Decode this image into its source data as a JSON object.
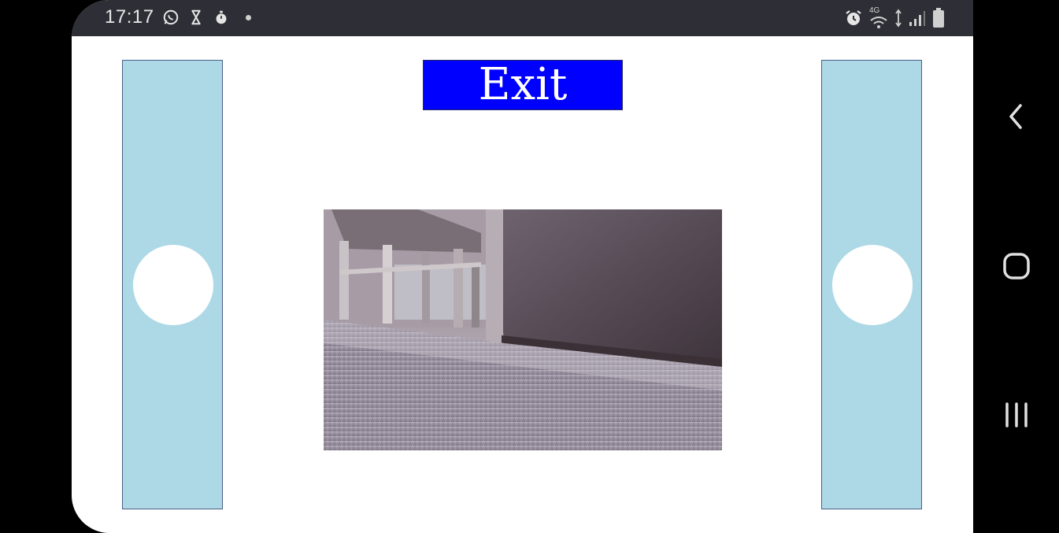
{
  "status_bar": {
    "time": "17:17",
    "left_icons": [
      "whatsapp-icon",
      "hourglass-icon",
      "stopwatch-icon",
      "notification-dot-icon"
    ],
    "right_icons": [
      "alarm-icon",
      "wifi-4g-icon",
      "data-arrows-icon",
      "cellular-signal-icon",
      "battery-icon"
    ],
    "network_label": "4G"
  },
  "controls": {
    "exit_label": "Exit",
    "left_slider_value": 0.5,
    "right_slider_value": 0.5
  },
  "camera": {
    "description_icon": "camera-feed"
  },
  "nav_bar": {
    "buttons": [
      "back-icon",
      "home-icon",
      "recents-icon"
    ]
  },
  "colors": {
    "slider_track": "#add8e6",
    "exit_button": "#0000ff",
    "status_bar": "#2e2f36"
  }
}
